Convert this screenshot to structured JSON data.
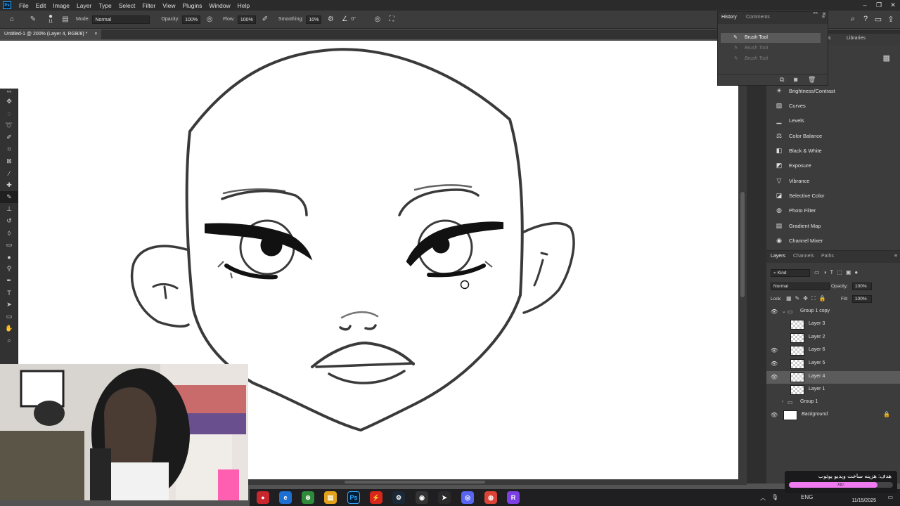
{
  "app": {
    "logo": "Ps",
    "menu": [
      "File",
      "Edit",
      "Image",
      "Layer",
      "Type",
      "Select",
      "Filter",
      "View",
      "Plugins",
      "Window",
      "Help"
    ]
  },
  "options": {
    "brush_size": "11",
    "mode_label": "Mode:",
    "mode_value": "Normal",
    "opacity_label": "Opacity:",
    "opacity_value": "100%",
    "flow_label": "Flow:",
    "flow_value": "100%",
    "smoothing_label": "Smoothing:",
    "smoothing_value": "10%",
    "angle_value": "0°"
  },
  "document": {
    "tab_title": "Untitled-1 @ 200% (Layer 4, RGB/8) *",
    "close": "×"
  },
  "history": {
    "tabs": [
      "History",
      "Comments"
    ],
    "items": [
      {
        "label": "Brush Tool",
        "state": "selected"
      },
      {
        "label": "Brush Tool",
        "state": "dim"
      },
      {
        "label": "Brush Tool",
        "state": "dim"
      }
    ]
  },
  "libraries": {
    "tab": "Libraries"
  },
  "adjustments": [
    {
      "label": "Brightness/Contrast",
      "icon": "brightness-icon"
    },
    {
      "label": "Curves",
      "icon": "curves-icon"
    },
    {
      "label": "Levels",
      "icon": "levels-icon"
    },
    {
      "label": "Color Balance",
      "icon": "color-balance-icon"
    },
    {
      "label": "Black & White",
      "icon": "black-white-icon"
    },
    {
      "label": "Exposure",
      "icon": "exposure-icon"
    },
    {
      "label": "Vibrance",
      "icon": "vibrance-icon"
    },
    {
      "label": "Selective Color",
      "icon": "selective-color-icon"
    },
    {
      "label": "Photo Filter",
      "icon": "photo-filter-icon"
    },
    {
      "label": "Gradient Map",
      "icon": "gradient-map-icon"
    },
    {
      "label": "Channel Mixer",
      "icon": "channel-mixer-icon"
    }
  ],
  "layers_panel": {
    "tabs": [
      "Layers",
      "Channels",
      "Paths"
    ],
    "filter": "Kind",
    "blend_mode": "Normal",
    "opacity_label": "Opacity:",
    "opacity_value": "100%",
    "lock_label": "Lock:",
    "fill_label": "Fill:",
    "fill_value": "100%",
    "layers": [
      {
        "name": "Group 1 copy",
        "type": "group-open",
        "visible": true
      },
      {
        "name": "Layer 3",
        "type": "layer",
        "visible": false
      },
      {
        "name": "Layer 2",
        "type": "layer",
        "visible": false
      },
      {
        "name": "Layer 6",
        "type": "layer",
        "visible": true
      },
      {
        "name": "Layer 5",
        "type": "layer",
        "visible": true
      },
      {
        "name": "Layer 4",
        "type": "layer",
        "visible": true,
        "selected": true
      },
      {
        "name": "Layer 1",
        "type": "layer",
        "visible": false
      },
      {
        "name": "Group 1",
        "type": "group",
        "visible": false
      },
      {
        "name": "Background",
        "type": "background",
        "visible": true
      }
    ]
  },
  "taskbar": {
    "apps": [
      "record-app",
      "edge",
      "xbox",
      "file-explorer",
      "photoshop",
      "adobe-acrobat",
      "steam",
      "obs",
      "cursor-app",
      "discord",
      "chrome",
      "r-app"
    ],
    "lang": "ENG",
    "date": "11/15/2025"
  },
  "stream_goal": {
    "title": "هدف: هزینه ساخت ویدیو یوتوب",
    "progress": 0.85,
    "progress_text": "٨٥٪"
  }
}
